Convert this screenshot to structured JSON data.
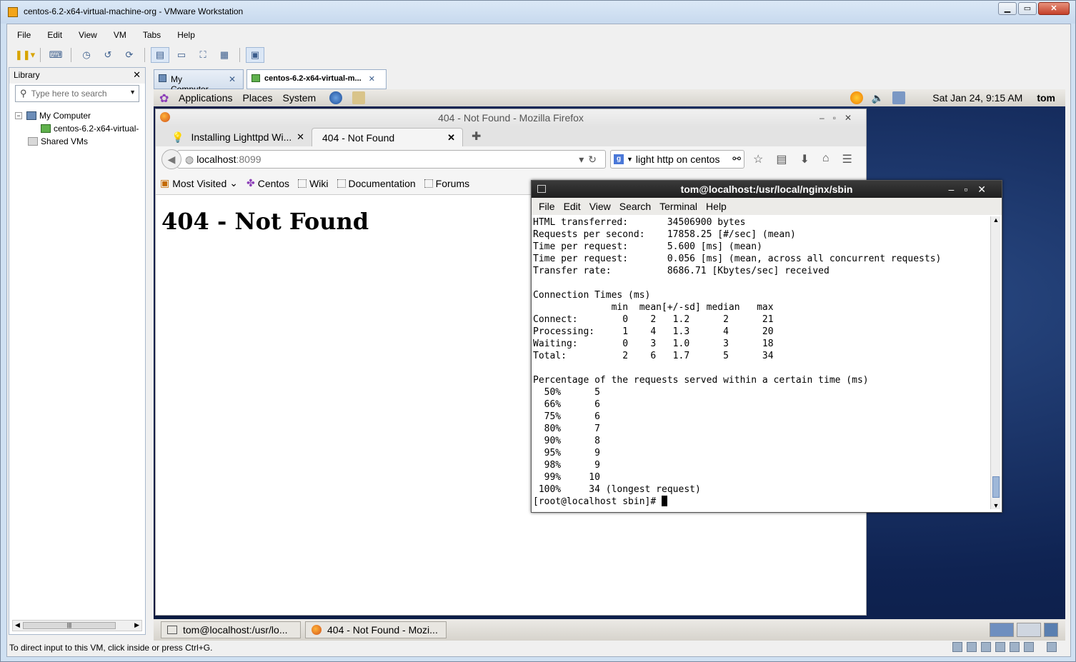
{
  "window": {
    "title": "centos-6.2-x64-virtual-machine-org - VMware Workstation"
  },
  "menu": [
    "File",
    "Edit",
    "View",
    "VM",
    "Tabs",
    "Help"
  ],
  "library": {
    "title": "Library",
    "search_placeholder": "Type here to search",
    "tree": {
      "root": "My Computer",
      "vm": "centos-6.2-x64-virtual-",
      "shared": "Shared VMs"
    }
  },
  "vm_tabs": [
    {
      "label": "My Computer"
    },
    {
      "label": "centos-6.2-x64-virtual-m..."
    }
  ],
  "guest_panel": {
    "menus": [
      "Applications",
      "Places",
      "System"
    ],
    "clock": "Sat Jan 24,  9:15 AM",
    "user": "tom"
  },
  "firefox": {
    "title": "404 - Not Found - Mozilla Firefox",
    "tabs": [
      {
        "label": "Installing Lighttpd Wi..."
      },
      {
        "label": "404 - Not Found"
      }
    ],
    "url_host": "localhost",
    "url_port": ":8099",
    "search_text": "light http on centos",
    "bookmarks": [
      "Most Visited",
      "Centos",
      "Wiki",
      "Documentation",
      "Forums"
    ],
    "page_heading": "404 - Not Found"
  },
  "terminal": {
    "title": "tom@localhost:/usr/local/nginx/sbin",
    "menu": [
      "File",
      "Edit",
      "View",
      "Search",
      "Terminal",
      "Help"
    ],
    "output": "HTML transferred:       34506900 bytes\nRequests per second:    17858.25 [#/sec] (mean)\nTime per request:       5.600 [ms] (mean)\nTime per request:       0.056 [ms] (mean, across all concurrent requests)\nTransfer rate:          8686.71 [Kbytes/sec] received\n\nConnection Times (ms)\n              min  mean[+/-sd] median   max\nConnect:        0    2   1.2      2      21\nProcessing:     1    4   1.3      4      20\nWaiting:        0    3   1.0      3      18\nTotal:          2    6   1.7      5      34\n\nPercentage of the requests served within a certain time (ms)\n  50%      5\n  66%      6\n  75%      6\n  80%      7\n  90%      8\n  95%      9\n  98%      9\n  99%     10\n 100%     34 (longest request)",
    "prompt": "[root@localhost sbin]# "
  },
  "taskbar": [
    {
      "label": "tom@localhost:/usr/lo..."
    },
    {
      "label": "404 - Not Found - Mozi..."
    }
  ],
  "status_text": "To direct input to this VM, click inside or press Ctrl+G."
}
